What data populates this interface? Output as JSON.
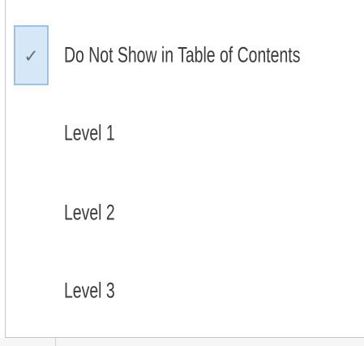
{
  "menu": {
    "items": [
      {
        "label": "Do Not Show in Table of Contents",
        "checked": true,
        "check_icon": "check-icon"
      },
      {
        "label": "Level 1",
        "checked": false
      },
      {
        "label": "Level 2",
        "checked": false
      },
      {
        "label": "Level 3",
        "checked": false
      }
    ]
  },
  "check_glyph": "✓",
  "colors": {
    "check_box_fill": "#d6e7f8",
    "check_box_border": "#9cc3e6",
    "label_text": "#3b3b3b"
  }
}
